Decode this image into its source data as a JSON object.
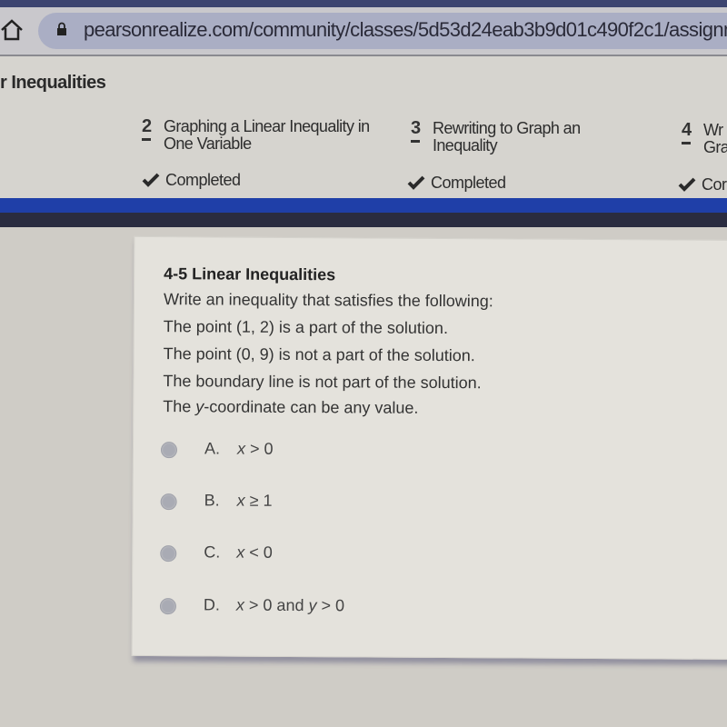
{
  "browser": {
    "url": "pearsonrealize.com/community/classes/5d53d24eab3b9d01c490f2c1/assignm",
    "icons": [
      "home-icon",
      "lock-icon"
    ]
  },
  "page": {
    "title": "r Inequalities"
  },
  "steps": [
    {
      "number": "2",
      "label_line1": "Graphing a Linear Inequality in",
      "label_line2": "One Variable",
      "status": "Completed"
    },
    {
      "number": "3",
      "label_line1": "Rewriting to Graph an",
      "label_line2": "Inequality",
      "status": "Completed"
    },
    {
      "number": "4",
      "label_line1": "Wr",
      "label_line2": "Gra",
      "status": "Cor"
    }
  ],
  "question": {
    "title": "4-5 Linear Inequalities",
    "lines": [
      "Write an inequality that satisfies the following:",
      "The point (1, 2) is a part of the solution.",
      "The point (0, 9) is not a part of the solution.",
      "The boundary line is not part of the solution."
    ],
    "last_line_prefix": "The ",
    "last_line_var": "y",
    "last_line_suffix": "-coordinate can be any value.",
    "options": [
      {
        "letter": "A.",
        "var1": "x",
        "rest1": " > 0",
        "mid": "",
        "var2": "",
        "rest2": "",
        "selected": false
      },
      {
        "letter": "B.",
        "var1": "x",
        "rest1": " ≥ 1",
        "mid": "",
        "var2": "",
        "rest2": "",
        "selected": false
      },
      {
        "letter": "C.",
        "var1": "x",
        "rest1": " < 0",
        "mid": "",
        "var2": "",
        "rest2": "",
        "selected": false
      },
      {
        "letter": "D.",
        "var1": "x",
        "rest1": " > 0",
        "mid": " and ",
        "var2": "y",
        "rest2": " > 0",
        "selected": false
      }
    ]
  }
}
